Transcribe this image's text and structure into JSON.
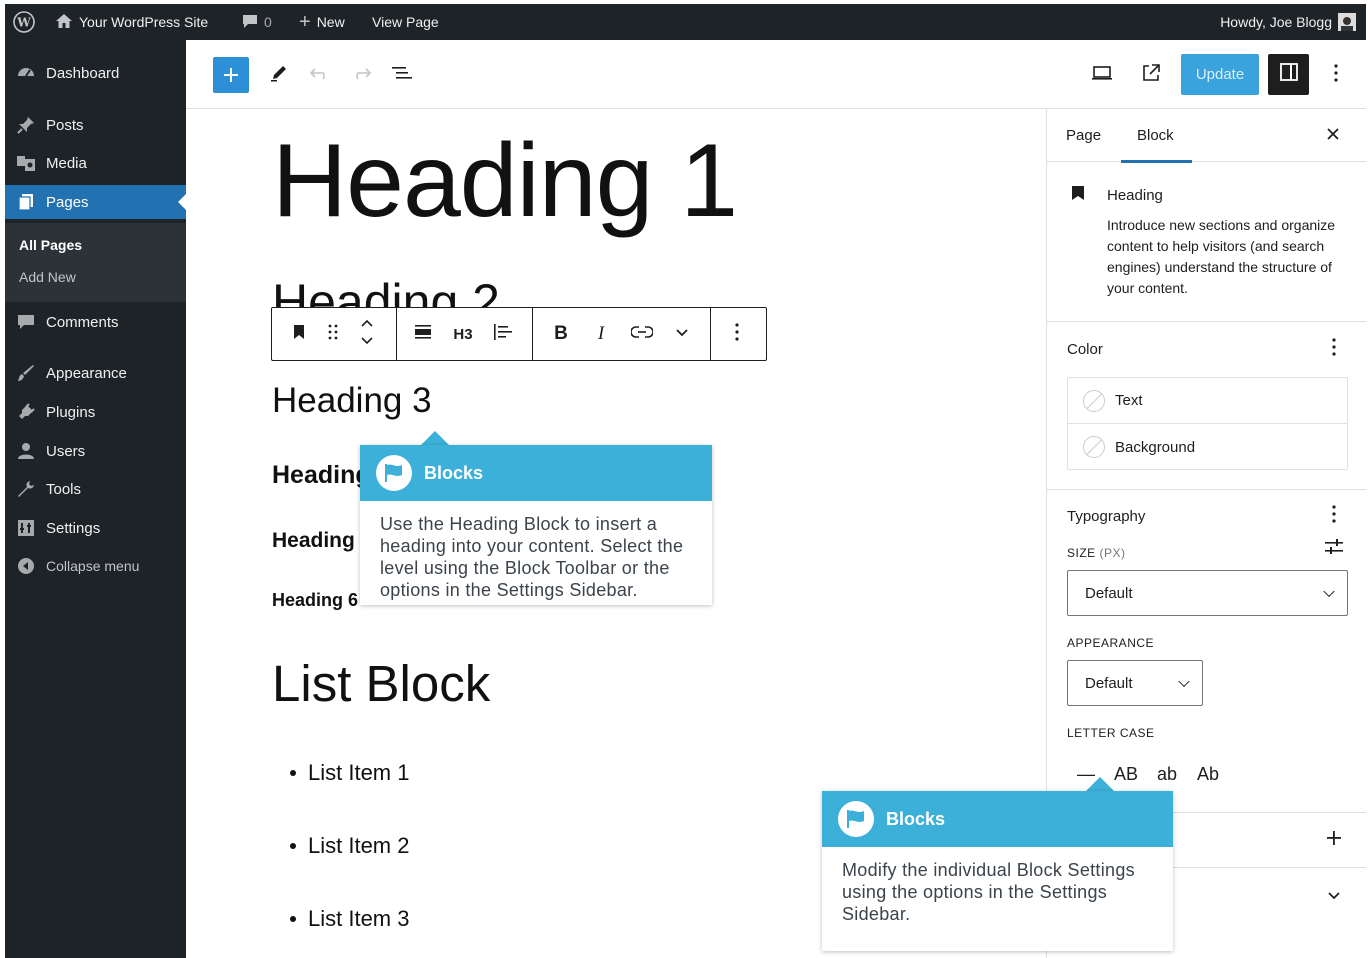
{
  "admin_bar": {
    "site_name": "Your WordPress Site",
    "comments_count": "0",
    "new_label": "New",
    "view_page_label": "View Page",
    "howdy": "Howdy, Joe Blogg"
  },
  "sidebar": {
    "items": [
      {
        "label": "Dashboard",
        "icon": "dashboard-icon"
      },
      {
        "label": "Posts",
        "icon": "pin-icon"
      },
      {
        "label": "Media",
        "icon": "media-icon"
      },
      {
        "label": "Pages",
        "icon": "pages-icon"
      },
      {
        "label": "Comments",
        "icon": "comment-icon"
      },
      {
        "label": "Appearance",
        "icon": "brush-icon"
      },
      {
        "label": "Plugins",
        "icon": "plug-icon"
      },
      {
        "label": "Users",
        "icon": "user-icon"
      },
      {
        "label": "Tools",
        "icon": "wrench-icon"
      },
      {
        "label": "Settings",
        "icon": "settings-icon"
      },
      {
        "label": "Collapse menu",
        "icon": "collapse-icon"
      }
    ],
    "submenu": [
      "All Pages",
      "Add New"
    ]
  },
  "toolbar": {
    "update_label": "Update"
  },
  "content": {
    "heading1": "Heading 1",
    "heading2": "Heading 2",
    "heading3": "Heading 3",
    "heading4": "Heading 4",
    "heading5": "Heading 5",
    "heading6": "Heading 6",
    "list_heading": "List Block",
    "list_items": [
      "List Item 1",
      "List Item 2",
      "List Item 3"
    ]
  },
  "block_toolbar": {
    "level_label": "H3",
    "bold_label": "B",
    "italic_label": "I"
  },
  "tooltips": [
    {
      "title": "Blocks",
      "body": "Use the Heading Block to insert a heading into your content. Select the level using the Block Toolbar or the options in the Settings Sidebar."
    },
    {
      "title": "Blocks",
      "body": "Modify the individual Block Settings using the options in the Settings Sidebar."
    }
  ],
  "settings": {
    "tabs": [
      "Page",
      "Block"
    ],
    "active_tab": "Block",
    "block_name": "Heading",
    "block_description": "Introduce new sections and organize content to help visitors (and search engines) understand the structure of your content.",
    "color": {
      "title": "Color",
      "options": [
        "Text",
        "Background"
      ]
    },
    "typography": {
      "title": "Typography",
      "size_label": "SIZE",
      "size_unit": "(PX)",
      "size_value": "Default",
      "appearance_label": "APPEARANCE",
      "appearance_value": "Default",
      "letter_case_label": "LETTER CASE",
      "letter_case_options": [
        "—",
        "AB",
        "ab",
        "Ab"
      ]
    }
  },
  "colors": {
    "admin_bg": "#1d2327",
    "accent": "#2271b1",
    "tooltip_header": "#3cb0d8"
  }
}
